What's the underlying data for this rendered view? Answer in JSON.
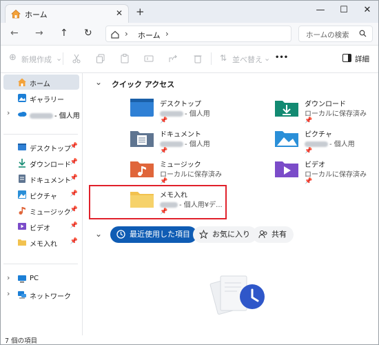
{
  "window": {
    "tab_title": "ホーム",
    "new_tab": "+",
    "minimize": "—",
    "maximize": "☐",
    "close": "✕"
  },
  "nav": {
    "back": "←",
    "forward": "→",
    "up": "↑",
    "refresh": "↻",
    "breadcrumb": [
      "ホーム"
    ],
    "search_placeholder": "ホームの検索"
  },
  "toolbar": {
    "new_label": "新規作成",
    "sort_label": "並べ替え",
    "more_label": "•••",
    "details_label": "詳細"
  },
  "sidebar": {
    "items": [
      {
        "label": "ホーム",
        "icon": "home-icon",
        "selected": true
      },
      {
        "label": "ギャラリー",
        "icon": "gallery-icon"
      },
      {
        "label": "- 個人用",
        "icon": "onedrive-icon"
      },
      {
        "label": "デスクトップ",
        "icon": "desktop-folder-icon"
      },
      {
        "label": "ダウンロード",
        "icon": "download-icon"
      },
      {
        "label": "ドキュメント",
        "icon": "documents-icon"
      },
      {
        "label": "ピクチャ",
        "icon": "pictures-icon"
      },
      {
        "label": "ミュージック",
        "icon": "music-icon"
      },
      {
        "label": "ビデオ",
        "icon": "videos-icon"
      },
      {
        "label": "メモ入れ",
        "icon": "folder-icon"
      },
      {
        "label": "PC",
        "icon": "pc-icon"
      },
      {
        "label": "ネットワーク",
        "icon": "network-icon"
      }
    ]
  },
  "quick_access": {
    "title": "クイック アクセス",
    "items": [
      {
        "name": "デスクトップ",
        "sub": "- 個人用",
        "color": "#2f80d5"
      },
      {
        "name": "ダウンロード",
        "sub": "ローカルに保存済み",
        "color": "#138a72"
      },
      {
        "name": "ドキュメント",
        "sub": "- 個人用",
        "color": "#5f7591"
      },
      {
        "name": "ピクチャ",
        "sub": "- 個人用",
        "color": "#2a8fd8"
      },
      {
        "name": "ミュージック",
        "sub": "ローカルに保存済み",
        "color": "#e0663b"
      },
      {
        "name": "ビデオ",
        "sub": "ローカルに保存済み",
        "color": "#7b4cc9"
      },
      {
        "name": "メモ入れ",
        "sub": "- 個人用¥デ...",
        "color": "#f2c24f"
      }
    ]
  },
  "filters": {
    "recent": "最近使用した項目",
    "favorites": "お気に入り",
    "shared": "共有"
  },
  "status": {
    "item_count": "7 個の項目"
  },
  "colors": {
    "accent": "#0f5cb4",
    "highlight_border": "#e0202a",
    "selected_bg": "#dde3eb"
  }
}
